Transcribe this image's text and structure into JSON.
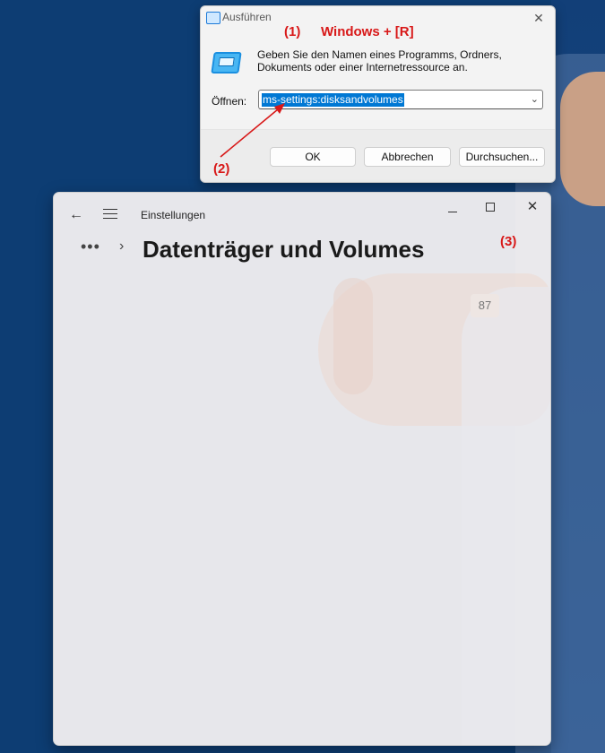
{
  "run_dialog": {
    "title": "Ausführen",
    "close_glyph": "✕",
    "description": "Geben Sie den Namen eines Programms, Ordners, Dokuments oder einer Internetressource an.",
    "open_label": "Öffnen:",
    "input_value": "ms-settings:disksandvolumes",
    "ok_label": "OK",
    "cancel_label": "Abbrechen",
    "browse_label": "Durchsuchen..."
  },
  "annotations": {
    "step1_num": "(1)",
    "step1_text": "Windows + [R]",
    "step2": "(2)",
    "step3": "(3)"
  },
  "settings": {
    "title": "Einstellungen",
    "back_glyph": "←",
    "close_glyph": "✕",
    "more_glyph": "•••",
    "chevron_glyph": "›",
    "page_title": "Datenträger und Volumes",
    "badge": "87"
  },
  "colors": {
    "annotation": "#d81818",
    "selection": "#0078d4",
    "background": "#0d3d73"
  }
}
